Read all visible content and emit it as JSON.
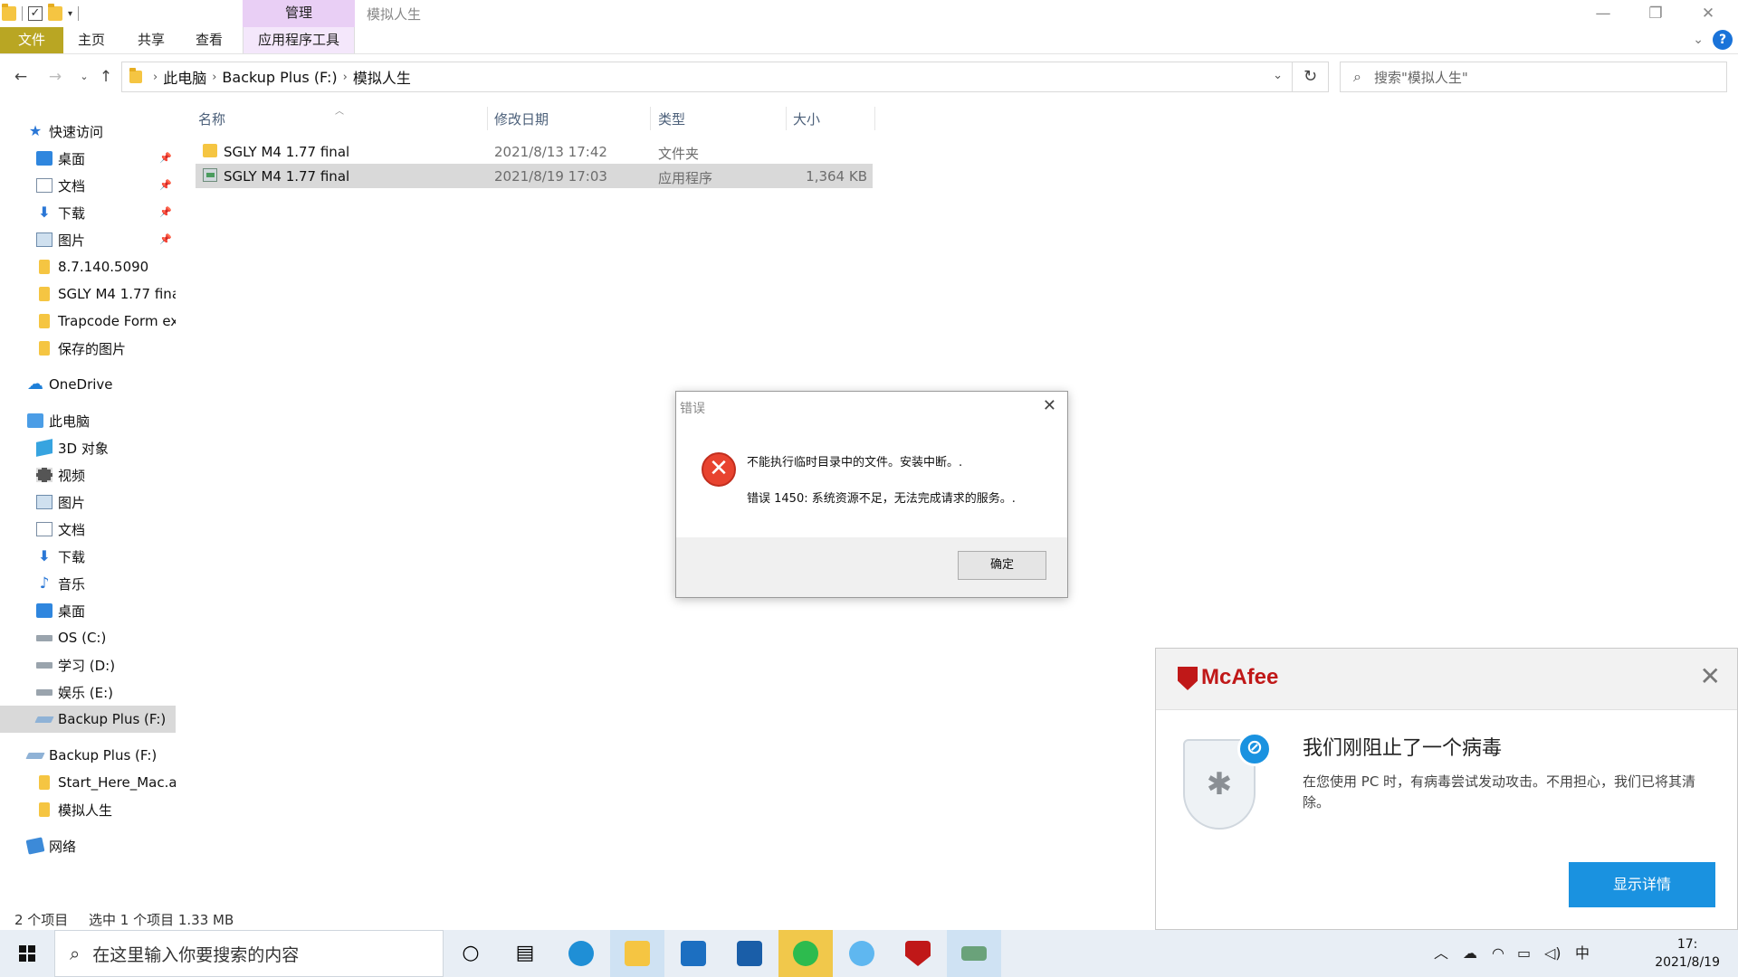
{
  "window": {
    "title": "模拟人生",
    "context_tab": "管理",
    "minimize": "—",
    "restore": "❐",
    "close": "✕"
  },
  "ribbon": {
    "tabs": [
      "文件",
      "主页",
      "共享",
      "查看",
      "应用程序工具"
    ],
    "help": "?"
  },
  "address": {
    "crumbs": [
      "此电脑",
      "Backup Plus (F:)",
      "模拟人生"
    ],
    "separator": "›",
    "search_placeholder": "搜索\"模拟人生\""
  },
  "sidebar": {
    "items": [
      {
        "label": "快速访问",
        "icon": "star-icon",
        "pinned": false
      },
      {
        "label": "桌面",
        "icon": "desktop-icon",
        "pinned": true
      },
      {
        "label": "文档",
        "icon": "document-icon",
        "pinned": true
      },
      {
        "label": "下载",
        "icon": "download-icon",
        "pinned": true
      },
      {
        "label": "图片",
        "icon": "pictures-icon",
        "pinned": true
      },
      {
        "label": "8.7.140.5090",
        "icon": "folder-icon",
        "pinned": false
      },
      {
        "label": "SGLY M4 1.77 fina",
        "icon": "folder-icon",
        "pinned": false
      },
      {
        "label": "Trapcode Form ex",
        "icon": "folder-icon",
        "pinned": false
      },
      {
        "label": "保存的图片",
        "icon": "folder-icon",
        "pinned": false
      },
      {
        "label": "OneDrive",
        "icon": "cloud-icon",
        "pinned": false
      },
      {
        "label": "此电脑",
        "icon": "computer-icon",
        "pinned": false
      },
      {
        "label": "3D 对象",
        "icon": "cube-icon",
        "pinned": false
      },
      {
        "label": "视频",
        "icon": "video-icon",
        "pinned": false
      },
      {
        "label": "图片",
        "icon": "pictures-icon",
        "pinned": false
      },
      {
        "label": "文档",
        "icon": "document-icon",
        "pinned": false
      },
      {
        "label": "下载",
        "icon": "download-icon",
        "pinned": false
      },
      {
        "label": "音乐",
        "icon": "music-icon",
        "pinned": false
      },
      {
        "label": "桌面",
        "icon": "desktop-icon",
        "pinned": false
      },
      {
        "label": "OS (C:)",
        "icon": "drive-icon",
        "pinned": false
      },
      {
        "label": "学习 (D:)",
        "icon": "drive-icon",
        "pinned": false
      },
      {
        "label": "娱乐 (E:)",
        "icon": "drive-icon",
        "pinned": false
      },
      {
        "label": "Backup Plus (F:)",
        "icon": "external-drive-icon",
        "pinned": false,
        "selected": true
      },
      {
        "label": "Backup Plus (F:)",
        "icon": "external-drive-icon",
        "pinned": false
      },
      {
        "label": "Start_Here_Mac.a",
        "icon": "folder-icon",
        "pinned": false
      },
      {
        "label": "模拟人生",
        "icon": "folder-icon",
        "pinned": false
      },
      {
        "label": "网络",
        "icon": "network-icon",
        "pinned": false
      }
    ]
  },
  "filelist": {
    "columns": [
      "名称",
      "修改日期",
      "类型",
      "大小"
    ],
    "rows": [
      {
        "name": "SGLY M4 1.77 final",
        "date": "2021/8/13 17:42",
        "type": "文件夹",
        "size": "",
        "icon": "folder-icon"
      },
      {
        "name": "SGLY M4 1.77 final",
        "date": "2021/8/19 17:03",
        "type": "应用程序",
        "size": "1,364 KB",
        "icon": "application-icon",
        "selected": true
      }
    ]
  },
  "statusbar": {
    "count": "2 个项目",
    "selection": "选中 1 个项目  1.33 MB"
  },
  "dialog": {
    "title": "错误",
    "message1": "不能执行临时目录中的文件。安装中断。.",
    "message2": "错误 1450: 系统资源不足，无法完成请求的服务。.",
    "ok": "确定"
  },
  "toast": {
    "brand": "McAfee",
    "title": "我们刚阻止了一个病毒",
    "body": "在您使用 PC 时，有病毒尝试发动攻击。不用担心，我们已将其清除。",
    "button": "显示详情",
    "accent": "#1a92e0",
    "brand_color": "#c01818"
  },
  "taskbar": {
    "search_placeholder": "在这里输入你要搜索的内容",
    "ime": "中",
    "time": "17:",
    "date": "2021/8/19"
  }
}
